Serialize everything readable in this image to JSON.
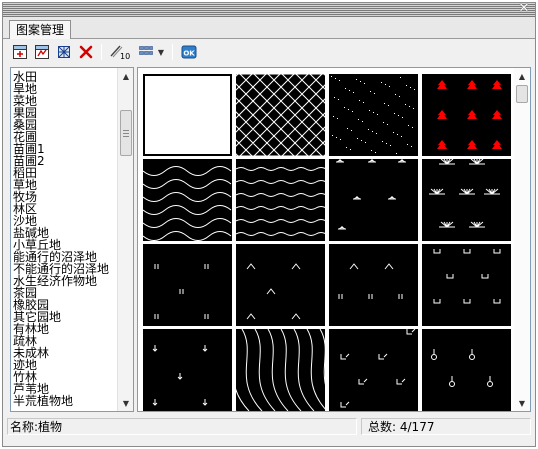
{
  "window": {
    "title": "",
    "close_symbol": "✕"
  },
  "tabs": [
    {
      "label": "图案管理"
    }
  ],
  "toolbar": {
    "buttons": [
      {
        "name": "add-pattern-icon"
      },
      {
        "name": "edit-pattern-icon"
      },
      {
        "name": "pattern-settings-icon"
      },
      {
        "name": "delete-icon"
      },
      {
        "name": "resize-pattern-icon"
      },
      {
        "name": "view-mode-icon"
      },
      {
        "name": "dropdown-arrow-icon"
      },
      {
        "name": "ok-icon",
        "label": "OK"
      }
    ],
    "dropdown_arrow": "▼",
    "resize_label": "10"
  },
  "pattern_list": {
    "items": [
      "水田",
      "旱地",
      "菜地",
      "果园",
      "桑园",
      "花圃",
      "苗圃1",
      "苗圃2",
      "稻田",
      "草地",
      "牧场",
      "林区",
      "沙地",
      "盐碱地",
      "小草丘地",
      "能通行的沼泽地",
      "不能通行的沼泽地",
      "水生经济作物地",
      "茶园",
      "橡胶园",
      "其它园地",
      "有林地",
      "疏林",
      "未成林",
      "迹地",
      "竹林",
      "芦苇地",
      "半荒植物地"
    ]
  },
  "scroll": {
    "up": "▲",
    "down": "▼"
  },
  "pattern_grid": {
    "tiles": [
      {
        "name": "pattern-tile-blank"
      },
      {
        "name": "pattern-tile-weave"
      },
      {
        "name": "pattern-tile-dots"
      },
      {
        "name": "pattern-tile-red-trees"
      },
      {
        "name": "pattern-tile-waves"
      },
      {
        "name": "pattern-tile-sine-waves"
      },
      {
        "name": "pattern-tile-sparse-grass"
      },
      {
        "name": "pattern-tile-grass-tufts"
      },
      {
        "name": "pattern-tile-marsh-ii"
      },
      {
        "name": "pattern-tile-chevrons"
      },
      {
        "name": "pattern-tile-marsh-mixed"
      },
      {
        "name": "pattern-tile-cups"
      },
      {
        "name": "pattern-tile-arrows"
      },
      {
        "name": "pattern-tile-contours"
      },
      {
        "name": "pattern-tile-checks"
      },
      {
        "name": "pattern-tile-circles"
      }
    ],
    "colors": {
      "fg": "#ffffff",
      "accent": "#ff0000",
      "bg": "#000000"
    }
  },
  "status": {
    "name_label": "名称:",
    "name_value": "植物",
    "count_label": "总数:",
    "count_value": "4/177"
  }
}
